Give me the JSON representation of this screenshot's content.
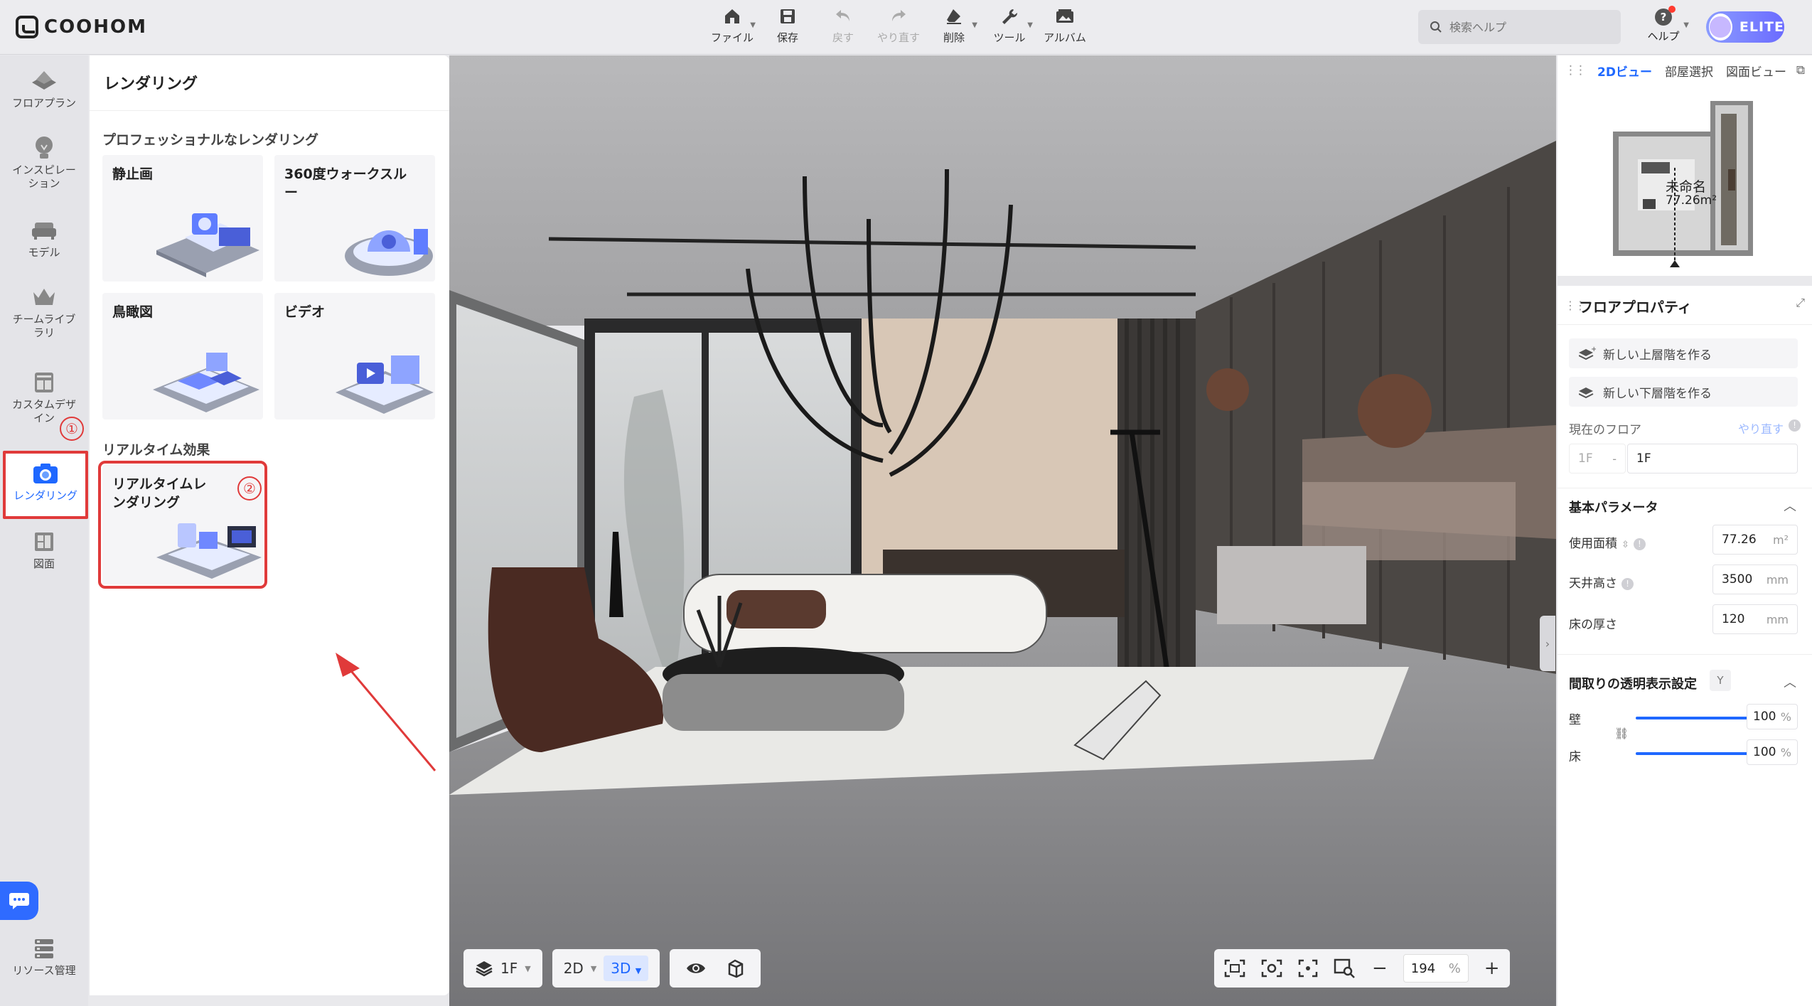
{
  "app": {
    "logo": "COOHOM"
  },
  "toolbar": {
    "items": [
      {
        "label": "ファイル",
        "icon": "home-icon",
        "disabled": false,
        "caret": true
      },
      {
        "label": "保存",
        "icon": "save-icon",
        "disabled": false,
        "caret": false
      },
      {
        "label": "戻す",
        "icon": "undo-icon",
        "disabled": true,
        "caret": false
      },
      {
        "label": "やり直す",
        "icon": "redo-icon",
        "disabled": true,
        "caret": false
      },
      {
        "label": "削除",
        "icon": "eraser-icon",
        "disabled": false,
        "caret": true
      },
      {
        "label": "ツール",
        "icon": "wrench-icon",
        "disabled": false,
        "caret": true
      },
      {
        "label": "アルバム",
        "icon": "album-icon",
        "disabled": false,
        "caret": false
      }
    ],
    "search_placeholder": "検索ヘルプ",
    "help_label": "ヘルプ",
    "elite_label": "ELITE"
  },
  "leftnav": {
    "items": [
      {
        "label": "フロアプラン",
        "icon": "floorplan-icon"
      },
      {
        "label": "インスピレーション",
        "icon": "lightbulb-icon"
      },
      {
        "label": "モデル",
        "icon": "sofa-icon"
      },
      {
        "label": "チームライブラリ",
        "icon": "crown-icon"
      },
      {
        "label": "カスタムデザイン",
        "icon": "cabinet-icon"
      },
      {
        "label": "レンダリング",
        "icon": "camera-icon"
      },
      {
        "label": "図面",
        "icon": "drawing-icon"
      },
      {
        "label": "リソース管理",
        "icon": "resource-icon"
      }
    ],
    "marker1": "①"
  },
  "render_panel": {
    "title": "レンダリング",
    "pro_section": "プロフェッショナルなレンダリング",
    "cards": [
      {
        "label": "静止画"
      },
      {
        "label": "360度ウォークスルー"
      },
      {
        "label": "鳥瞰図"
      },
      {
        "label": "ビデオ"
      }
    ],
    "realtime_section": "リアルタイム効果",
    "realtime_card": "リアルタイムレンダリング",
    "marker2": "②"
  },
  "viewport": {
    "floor_selector": "1F",
    "view_2d": "2D",
    "view_3d": "3D",
    "zoom_value": "194",
    "zoom_unit": "%"
  },
  "right_panel": {
    "tabs": [
      "2Dビュー",
      "部屋選択",
      "図面ビュー"
    ],
    "minimap_room_name": "未命名",
    "minimap_room_area": "77.26m²",
    "props_title": "フロアプロパティ",
    "btn_upper": "新しい上層階を作る",
    "btn_lower": "新しい下層階を作る",
    "current_floor_label": "現在のフロア",
    "redo_link": "やり直す",
    "floor_code": "1F",
    "floor_name": "1F",
    "basic_params": "基本パラメータ",
    "area_label": "使用面積",
    "area_value": "77.26",
    "area_unit": "m²",
    "ceiling_label": "天井高さ",
    "ceiling_value": "3500",
    "ceiling_unit": "mm",
    "floor_thick_label": "床の厚さ",
    "floor_thick_value": "120",
    "floor_thick_unit": "mm",
    "transparency_label": "間取りの透明表示設定",
    "transparency_key": "Y",
    "wall_label": "壁",
    "wall_value": "100",
    "floor_label": "床",
    "floor_value": "100",
    "pct": "%"
  }
}
